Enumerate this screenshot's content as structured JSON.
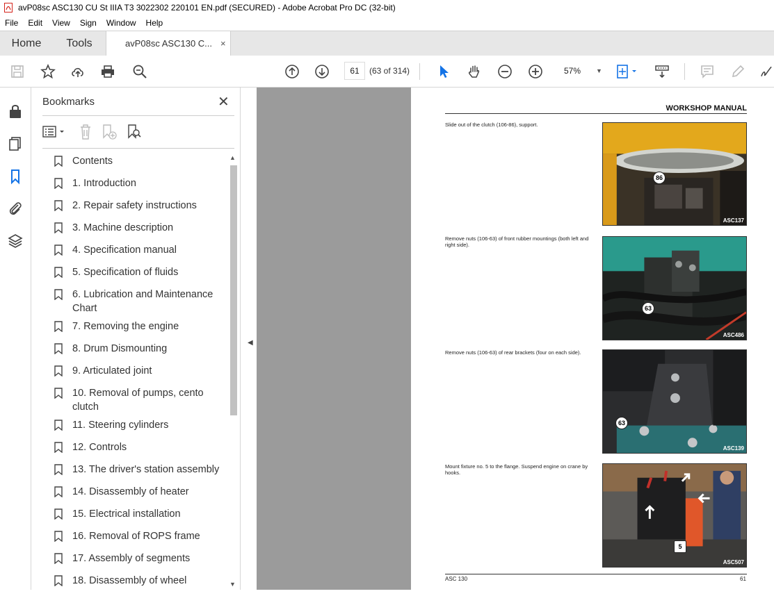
{
  "window": {
    "title": "avP08sc ASC130 CU St IIIA T3 3022302 220101 EN.pdf (SECURED) - Adobe Acrobat Pro DC (32-bit)"
  },
  "menu": [
    "File",
    "Edit",
    "View",
    "Sign",
    "Window",
    "Help"
  ],
  "tabs": {
    "home": "Home",
    "tools": "Tools",
    "doc": "avP08sc ASC130 C...",
    "doc_close": "×"
  },
  "toolbar": {
    "page_current": "61",
    "page_count": "(63 of 314)",
    "zoom": "57%"
  },
  "bookmarks": {
    "title": "Bookmarks",
    "close": "✕",
    "items": [
      "Contents",
      "1. Introduction",
      "2. Repair safety instructions",
      "3. Machine description",
      "4. Specification manual",
      "5. Specification of fluids",
      "6. Lubrication and Maintenance Chart",
      "7. Removing the engine",
      "8. Drum Dismounting",
      "9. Articulated joint",
      "10. Removal of pumps, cento clutch",
      "11. Steering cylinders",
      "12. Controls",
      "13. The driver's station assembly",
      "14. Disassembly of heater",
      "15. Electrical installation",
      "16. Removal of ROPS frame",
      "17. Assembly of segments",
      "18. Disassembly of wheel"
    ]
  },
  "page": {
    "header": "WORKSHOP MANUAL",
    "steps": [
      {
        "text": "Slide out of the clutch (106-86), support.",
        "callout": "86",
        "tag": "ASC137"
      },
      {
        "text": "Remove nuts (106-63) of front rubber mountings (both left and right side).",
        "callout": "63",
        "tag": "ASC486"
      },
      {
        "text": "Remove nuts (106-63) of rear brackets (four on each side).",
        "callout": "63",
        "tag": "ASC139"
      },
      {
        "text": "Mount fixture no. 5 to the flange. Suspend engine on crane by hooks.",
        "callout": "5",
        "tag": "ASC507"
      }
    ],
    "footer_left": "ASC 130",
    "footer_right": "61"
  },
  "colors": {
    "accent_blue": "#1473e6",
    "pdf_red": "#d4221a",
    "viewer_gray": "#9b9b9b"
  }
}
